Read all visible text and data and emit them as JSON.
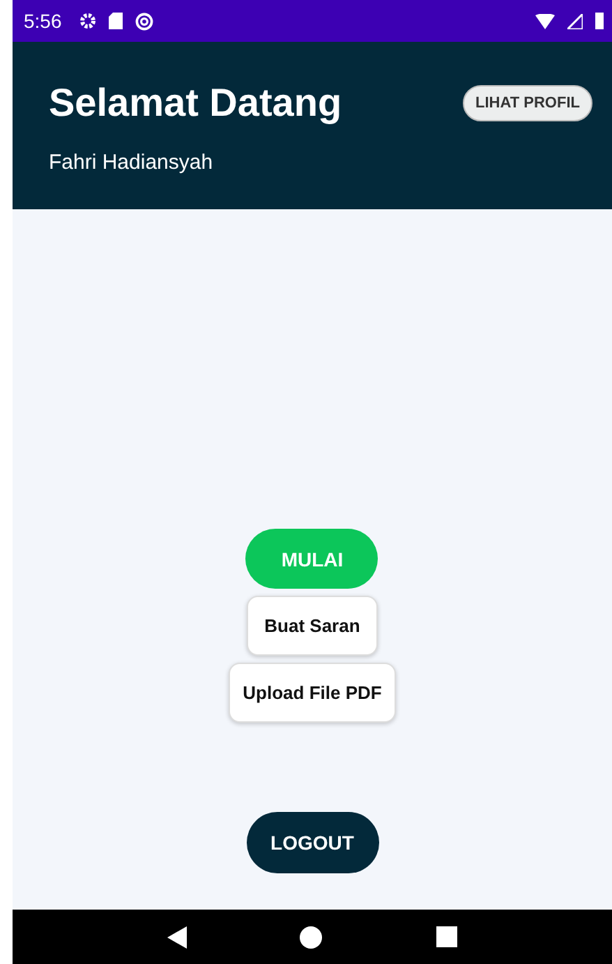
{
  "status_bar": {
    "time": "5:56"
  },
  "header": {
    "title": "Selamat Datang",
    "subtitle": "Fahri Hadiansyah",
    "profile_button": "LIHAT PROFIL"
  },
  "actions": [
    {
      "label": "MULAI",
      "kind": "primary"
    },
    {
      "label": "Buat Saran",
      "kind": "card"
    },
    {
      "label": "Upload File PDF",
      "kind": "card"
    }
  ],
  "logout_button": "LOGOUT"
}
